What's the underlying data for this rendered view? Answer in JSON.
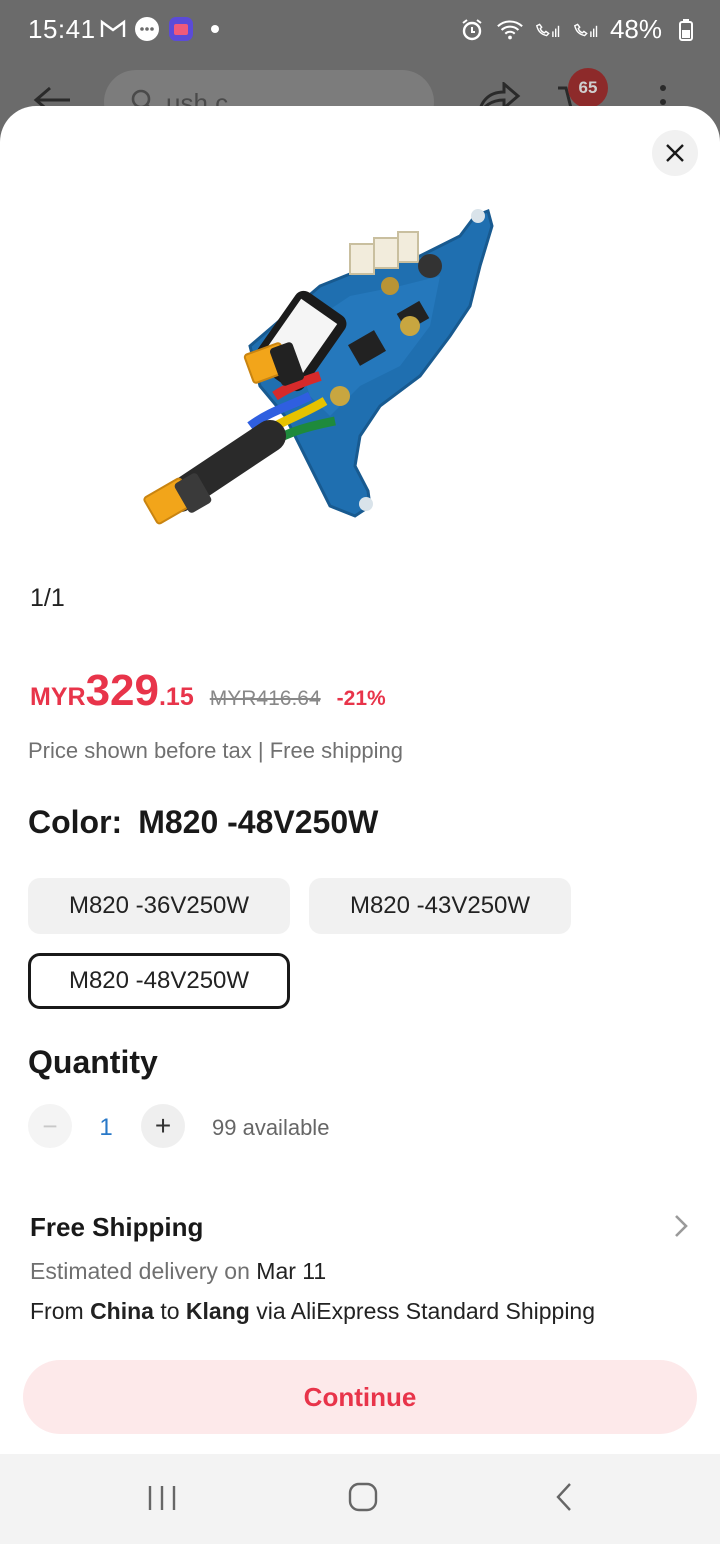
{
  "status_bar": {
    "time": "15:41",
    "battery": "48%",
    "left_icons": [
      "gmail-icon",
      "messages-icon",
      "lazada-icon",
      "dot-icon"
    ],
    "right_icons": [
      "alarm-icon",
      "wifi-icon",
      "wifi-call-1-icon",
      "wifi-call-2-icon",
      "battery-icon"
    ]
  },
  "app_header": {
    "search_text": "ush c",
    "cart_count": "65"
  },
  "sheet": {
    "image_counter": "1/1",
    "price": {
      "currency": "MYR",
      "integer": "329",
      "decimal": ".15",
      "original": "MYR416.64",
      "discount": "-21%"
    },
    "tax_note": "Price shown before tax | Free shipping",
    "color": {
      "label": "Color:",
      "selected": "M820 -48V250W",
      "options": [
        "M820 -36V250W",
        "M820 -43V250W",
        "M820 -48V250W"
      ]
    },
    "quantity": {
      "title": "Quantity",
      "minus": "−",
      "value": "1",
      "plus": "+",
      "available": "99 available"
    },
    "shipping": {
      "title": "Free Shipping",
      "est_prefix": "Estimated delivery on",
      "est_date": "Mar 11",
      "route_from_word": "From",
      "route_from": "China",
      "route_to_word": "to",
      "route_to": "Klang",
      "route_via": "via AliExpress Standard Shipping"
    },
    "continue_label": "Continue"
  },
  "colors": {
    "accent": "#e8344a",
    "continue_bg": "#fde9ea",
    "qty_value": "#2878c8"
  }
}
